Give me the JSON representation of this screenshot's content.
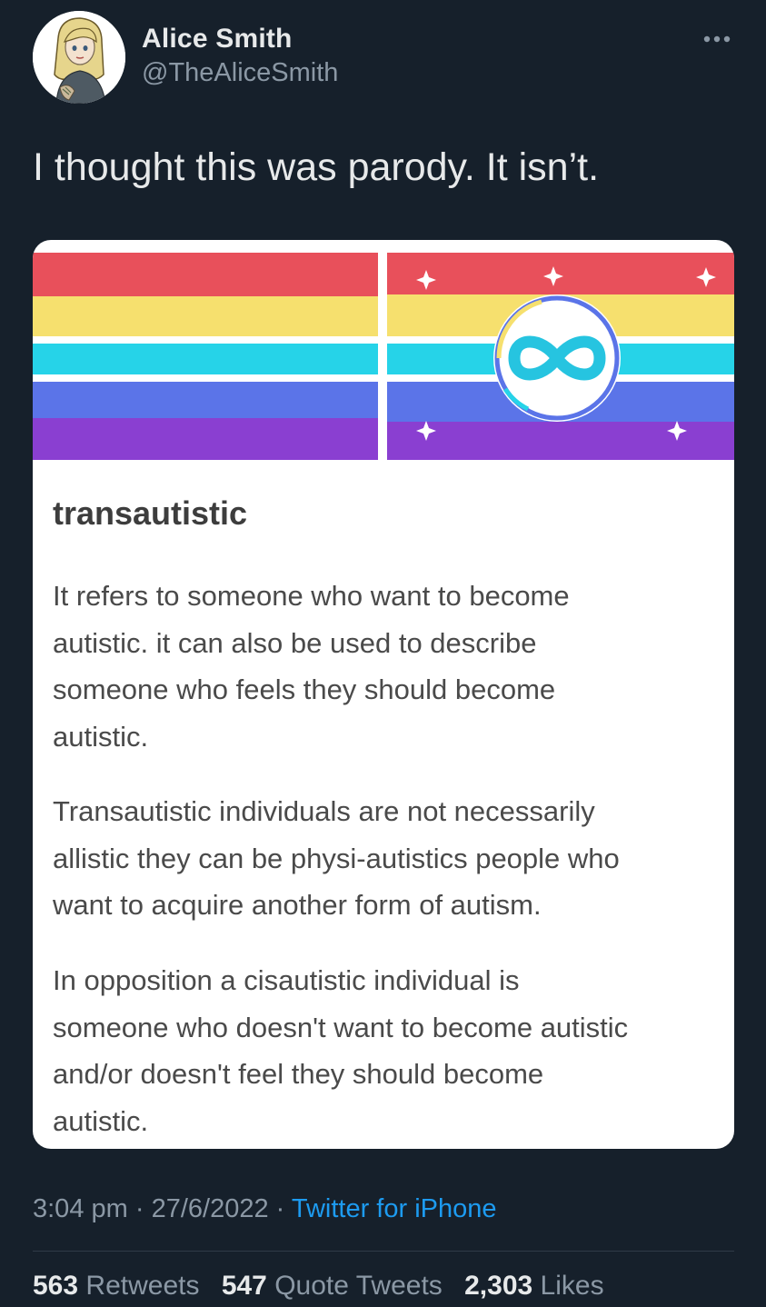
{
  "author": {
    "display_name": "Alice Smith",
    "handle": "@TheAliceSmith",
    "avatar_icon": "cartoon-woman-avatar"
  },
  "more_icon": "more-horizontal-icon",
  "tweet_text": "I thought this was parody. It isn’t.",
  "card": {
    "flags": {
      "left_stripes": [
        "#e8505b",
        "#f6e06e",
        "#26d3e8",
        "#5b74e8",
        "#8a3fd1"
      ],
      "right_stripes": [
        "#e8505b",
        "#f6e06e",
        "#26d3e8",
        "#5b74e8",
        "#8a3fd1"
      ],
      "center_symbol": "infinity-icon",
      "accent_symbol": "sparkle-icon"
    },
    "title": "transautistic",
    "paragraphs": [
      [
        "It refers to someone who want to become",
        "autistic. it can also be used to describe",
        "someone who feels they should become",
        "autistic."
      ],
      [
        "Transautistic individuals are not necessarily",
        "allistic they can be physi-autistics people who",
        "want to acquire another form of autism."
      ],
      [
        "In opposition a cisautistic individual is",
        "someone who doesn't want to become autistic",
        "and/or doesn't feel they should become",
        "autistic."
      ]
    ]
  },
  "meta": {
    "time": "3:04 pm",
    "sep1": " · ",
    "date": "27/6/2022",
    "sep2": " · ",
    "source": "Twitter for iPhone"
  },
  "stats": {
    "retweets": {
      "count": "563",
      "label": "Retweets"
    },
    "quote_tweets": {
      "count": "547",
      "label": "Quote Tweets"
    },
    "likes": {
      "count": "2,303",
      "label": "Likes"
    }
  },
  "colors": {
    "background": "#16202b",
    "text_primary": "#e7e9ea",
    "text_secondary": "#8b98a5",
    "link": "#1d9bf0"
  }
}
